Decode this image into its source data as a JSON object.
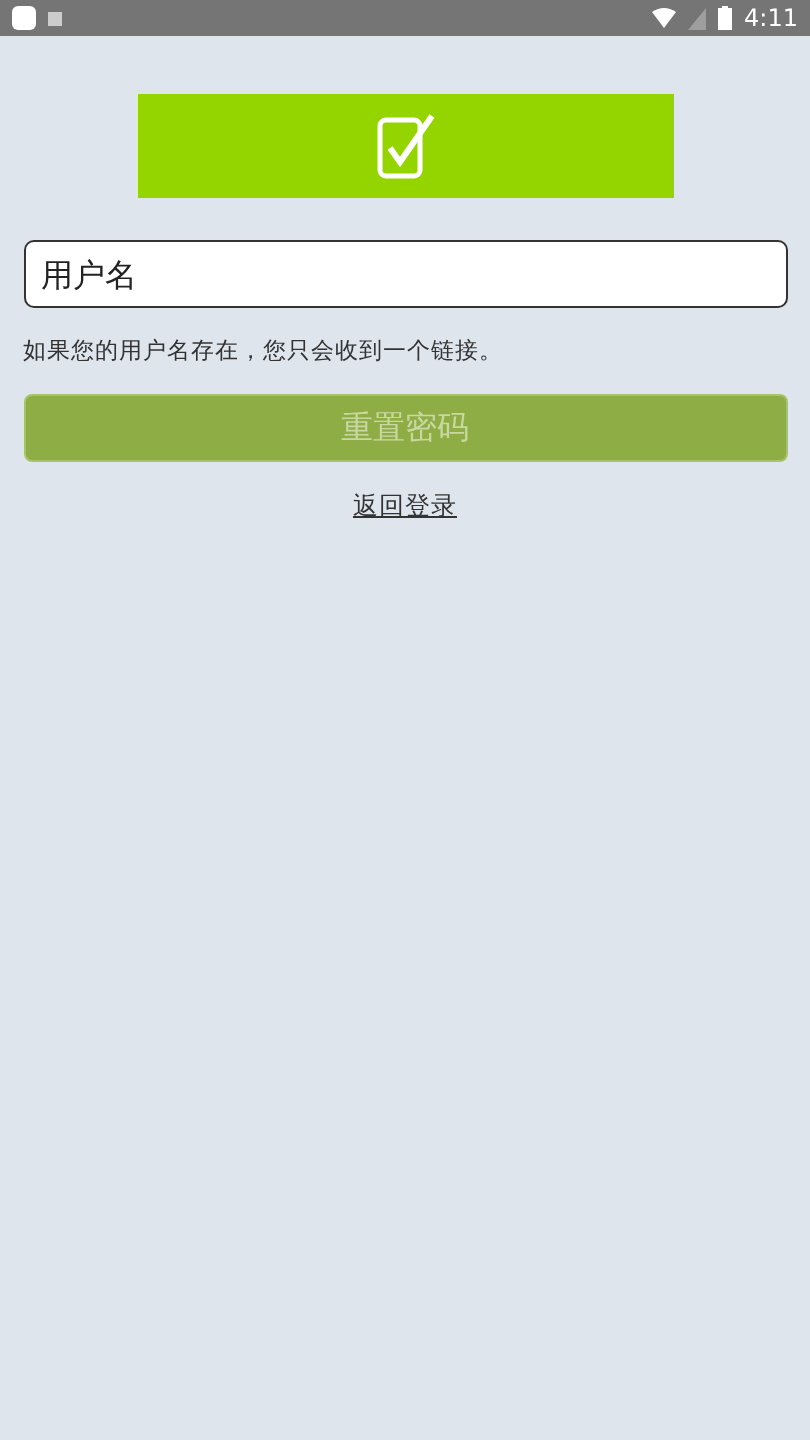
{
  "status_bar": {
    "time": "4:11"
  },
  "username_field": {
    "placeholder": "用户名"
  },
  "hint": "如果您的用户名存在，您只会收到一个链接。",
  "reset_button": {
    "label": "重置密码",
    "disabled": true
  },
  "back_link": "返回登录"
}
